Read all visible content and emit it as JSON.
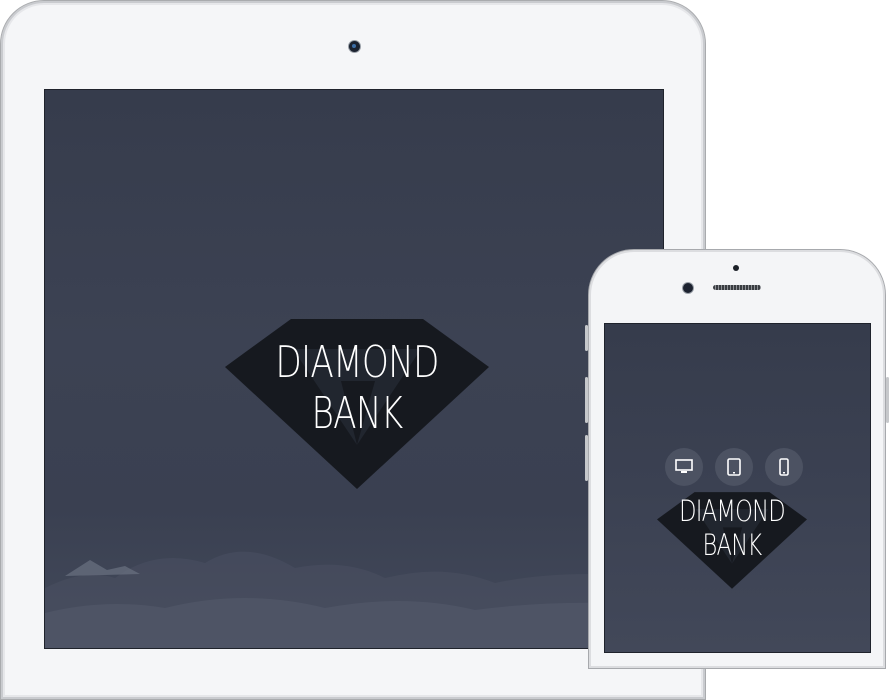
{
  "brand": {
    "name": "DIAMOND BANK"
  },
  "device_switcher": {
    "items": [
      {
        "icon": "desktop-icon"
      },
      {
        "icon": "tablet-icon"
      },
      {
        "icon": "phone-icon"
      }
    ]
  },
  "colors": {
    "screen_bg": "#3a4050",
    "logo_diamond": "#16191f",
    "logo_text": "#ffffff",
    "device_frame": "#f5f6f8",
    "switcher_button": "#4c5262"
  }
}
